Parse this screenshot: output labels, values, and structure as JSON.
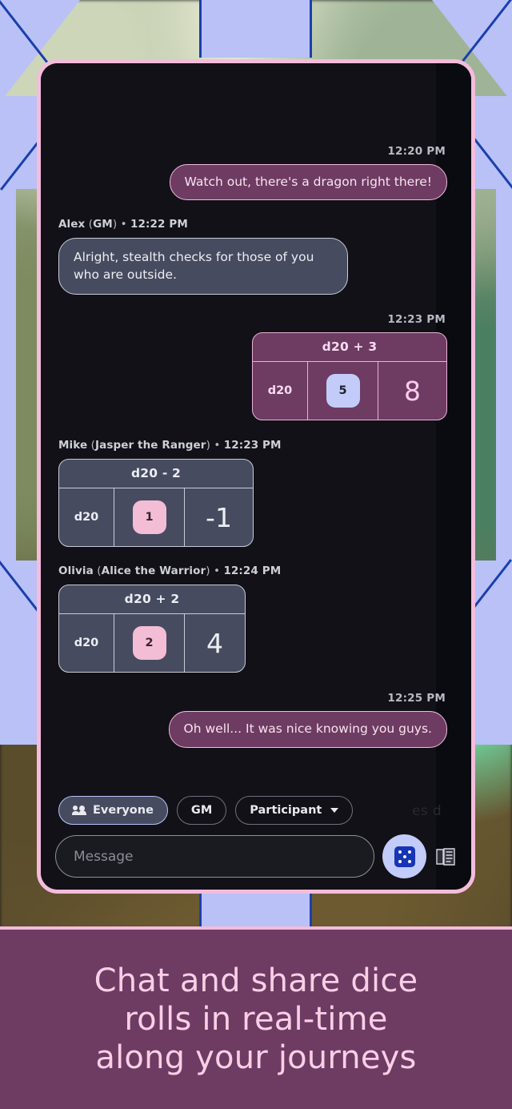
{
  "caption": {
    "line1": "Chat and share dice",
    "line2": "rolls in real-time",
    "line3": "along your journeys"
  },
  "drawer": {
    "cut_off_label": "es d"
  },
  "chat": {
    "items": [
      {
        "kind": "message",
        "side": "outgoing",
        "timestamp": "12:20 PM",
        "text": "Watch out, there's a dragon right there!"
      },
      {
        "kind": "message",
        "side": "incoming",
        "sender": "Alex",
        "role": "GM",
        "timestamp": "12:22 PM",
        "text": "Alright, stealth checks for those of you who are outside."
      },
      {
        "kind": "roll",
        "side": "outgoing",
        "timestamp": "12:23 PM",
        "formula": "d20 + 3",
        "die_label": "d20",
        "die_value": "5",
        "die_chip_color": "periwinkle",
        "total": "8"
      },
      {
        "kind": "roll",
        "side": "incoming",
        "sender": "Mike",
        "role": "Jasper the Ranger",
        "timestamp": "12:23 PM",
        "formula": "d20 - 2",
        "die_label": "d20",
        "die_value": "1",
        "die_chip_color": "pink",
        "total": "-1"
      },
      {
        "kind": "roll",
        "side": "incoming",
        "sender": "Olivia",
        "role": "Alice the Warrior",
        "timestamp": "12:24 PM",
        "formula": "d20 + 2",
        "die_label": "d20",
        "die_value": "2",
        "die_chip_color": "pink",
        "total": "4"
      },
      {
        "kind": "message",
        "side": "outgoing",
        "timestamp": "12:25 PM",
        "text": "Oh well... It was nice knowing you guys."
      }
    ]
  },
  "filters": {
    "everyone": {
      "label": "Everyone",
      "icon": "people-icon",
      "selected": true
    },
    "gm": {
      "label": "GM",
      "selected": false
    },
    "participant": {
      "label": "Participant",
      "icon": "chevron-down-icon",
      "selected": false
    }
  },
  "composer": {
    "placeholder": "Message",
    "value": "",
    "dice_button_icon": "dice-five-icon",
    "book_button_icon": "book-icon"
  },
  "colors": {
    "frame_pink": "#f4bcdc",
    "bubble_out": "#6e3b63",
    "bubble_in": "#474b5f",
    "chip_periwinkle": "#c3cbf9",
    "chip_pink": "#f3bdd6",
    "caption_bg": "#6e3b63",
    "caption_text": "#f9cfe6",
    "bg_periwinkle": "#b9c1f6",
    "bg_outline_blue": "#1b3fae"
  }
}
